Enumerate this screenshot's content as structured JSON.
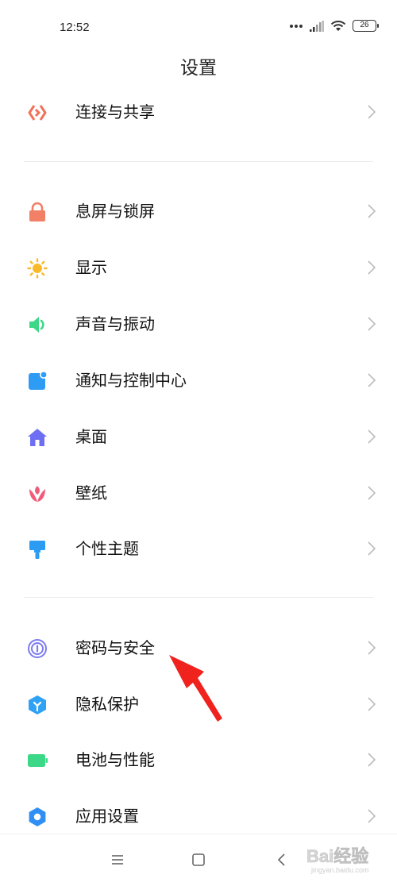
{
  "status": {
    "time": "12:52",
    "battery": "26"
  },
  "page": {
    "title": "设置"
  },
  "colors": {
    "connection": "#F0735A",
    "lock": "#F28066",
    "display": "#F9B92B",
    "sound": "#3DD887",
    "notification": "#2E9BF5",
    "desktop": "#6E6EF3",
    "wallpaper": "#F25A7A",
    "theme": "#2C9CF2",
    "password": "#7B7BEF",
    "privacy": "#2FA2F6",
    "battery": "#3DD887",
    "apps": "#2F8FF4",
    "arrow": "#F0221E"
  },
  "groups": [
    {
      "items": [
        {
          "label": "连接与共享",
          "icon": "connection-icon"
        }
      ]
    },
    {
      "items": [
        {
          "label": "息屏与锁屏",
          "icon": "lock-icon"
        },
        {
          "label": "显示",
          "icon": "sun-icon"
        },
        {
          "label": "声音与振动",
          "icon": "speaker-icon"
        },
        {
          "label": "通知与控制中心",
          "icon": "notification-icon"
        },
        {
          "label": "桌面",
          "icon": "home-icon"
        },
        {
          "label": "壁纸",
          "icon": "flower-icon"
        },
        {
          "label": "个性主题",
          "icon": "brush-icon"
        }
      ]
    },
    {
      "items": [
        {
          "label": "密码与安全",
          "icon": "fingerprint-icon"
        },
        {
          "label": "隐私保护",
          "icon": "privacy-shield-icon"
        },
        {
          "label": "电池与性能",
          "icon": "battery-icon"
        },
        {
          "label": "应用设置",
          "icon": "gear-icon"
        }
      ]
    }
  ],
  "nav": {
    "menu": "menu-icon",
    "home": "home-square-icon",
    "back": "back-icon"
  },
  "watermark": {
    "text": "Bai经验",
    "subtext": "jingyan.baidu.com"
  }
}
